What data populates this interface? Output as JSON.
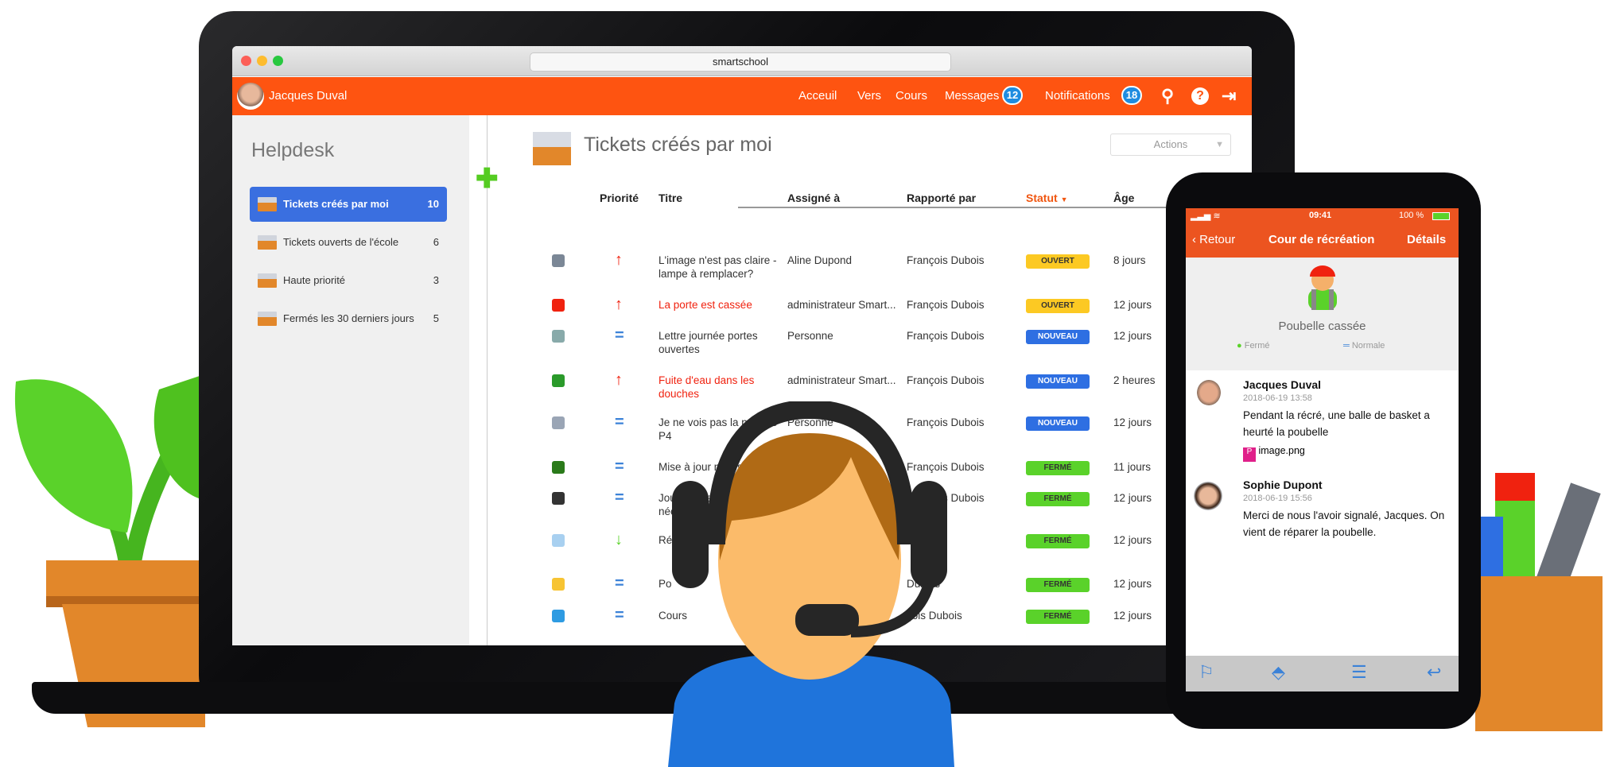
{
  "browser": {
    "url": "smartschool"
  },
  "nav": {
    "user": "Jacques Duval",
    "links": [
      "Acceuil",
      "Vers",
      "Cours"
    ],
    "messages": "Messages",
    "messages_count": "12",
    "notifications": "Notifications",
    "notifications_count": "18",
    "icons": [
      "search-icon",
      "help-icon",
      "logout-icon"
    ],
    "color": "#fe5411"
  },
  "sidebar": {
    "title": "Helpdesk",
    "items": [
      {
        "label": "Tickets créés par moi",
        "count": "10",
        "active": true
      },
      {
        "label": "Tickets ouverts de l'école",
        "count": "6"
      },
      {
        "label": "Haute priorité",
        "count": "3"
      },
      {
        "label": "Fermés les 30 derniers jours",
        "count": "5"
      }
    ]
  },
  "main": {
    "title": "Tickets créés par moi",
    "actions": "Actions",
    "columns": [
      "Priorité",
      "Titre",
      "Assigné à",
      "Rapporté par",
      "Statut",
      "Âge"
    ],
    "rows": [
      {
        "icon": "projector",
        "priority": "high",
        "title": "L'image n'est pas claire - lampe à remplacer?",
        "assigned": "Aline Dupond",
        "reporter": "François Dubois",
        "status": "OUVERT",
        "age": "8 jours"
      },
      {
        "icon": "student",
        "priority": "high",
        "title": "La porte est cassée",
        "highlight": true,
        "assigned": "administrateur Smart...",
        "reporter": "François Dubois",
        "status": "OUVERT",
        "age": "12 jours"
      },
      {
        "icon": "document",
        "priority": "normal",
        "title": "Lettre journée portes ouvertes",
        "assigned": "Personne",
        "reporter": "François Dubois",
        "status": "NOUVEAU",
        "age": "12 jours"
      },
      {
        "icon": "field",
        "priority": "high",
        "title": "Fuite d'eau dans les douches",
        "highlight": true,
        "assigned": "administrateur Smart...",
        "reporter": "François Dubois",
        "status": "NOUVEAU",
        "age": "2 heures"
      },
      {
        "icon": "tag",
        "priority": "normal",
        "title": "Je ne vois pas la période P4",
        "assigned": "Personne",
        "reporter": "François Dubois",
        "status": "NOUVEAU",
        "age": "12 jours"
      },
      {
        "icon": "blackboard",
        "priority": "normal",
        "title": "Mise à jour nécess",
        "assigned": "",
        "reporter": "François Dubois",
        "status": "FERMÉ",
        "age": "11 jours"
      },
      {
        "icon": "graduate",
        "priority": "normal",
        "title": "Journée des e de néerlanda",
        "assigned": "",
        "reporter": "François Dubois",
        "status": "FERMÉ",
        "age": "12 jours"
      },
      {
        "icon": "weather",
        "priority": "low",
        "title": "Ré de",
        "assigned": "",
        "reporter": "Dubois",
        "status": "FERMÉ",
        "age": "12 jours"
      },
      {
        "icon": "house",
        "priority": "normal",
        "title": "Po",
        "assigned": "",
        "reporter": "Dubois",
        "status": "FERMÉ",
        "age": "12 jours"
      },
      {
        "icon": "binders",
        "priority": "normal",
        "title": "Cours",
        "assigned": "",
        "reporter": "çois Dubois",
        "status": "FERMÉ",
        "age": "12 jours"
      }
    ]
  },
  "status_colors": {
    "OUVERT": "#fcc923",
    "NOUVEAU": "#2e6fe2",
    "FERMÉ": "#5ad22a"
  },
  "phone": {
    "time": "09:41",
    "battery": "100 %",
    "back": "Retour",
    "title": "Cour de récréation",
    "details": "Détails",
    "ticket": "Poubelle cassée",
    "state": "Fermé",
    "priority": "Normale",
    "messages": [
      {
        "name": "Jacques Duval",
        "date": "2018-06-19 13:58",
        "text": "Pendant la récré, une balle de basket a heurté la poubelle",
        "attachment": "image.png"
      },
      {
        "name": "Sophie Dupont",
        "date": "2018-06-19 15:56",
        "text": "Merci de nous l'avoir signalé, Jacques. On vient de réparer la poubelle."
      }
    ],
    "toolbar": [
      "flag-icon",
      "priority-icon",
      "notes-icon",
      "reply-icon"
    ]
  }
}
